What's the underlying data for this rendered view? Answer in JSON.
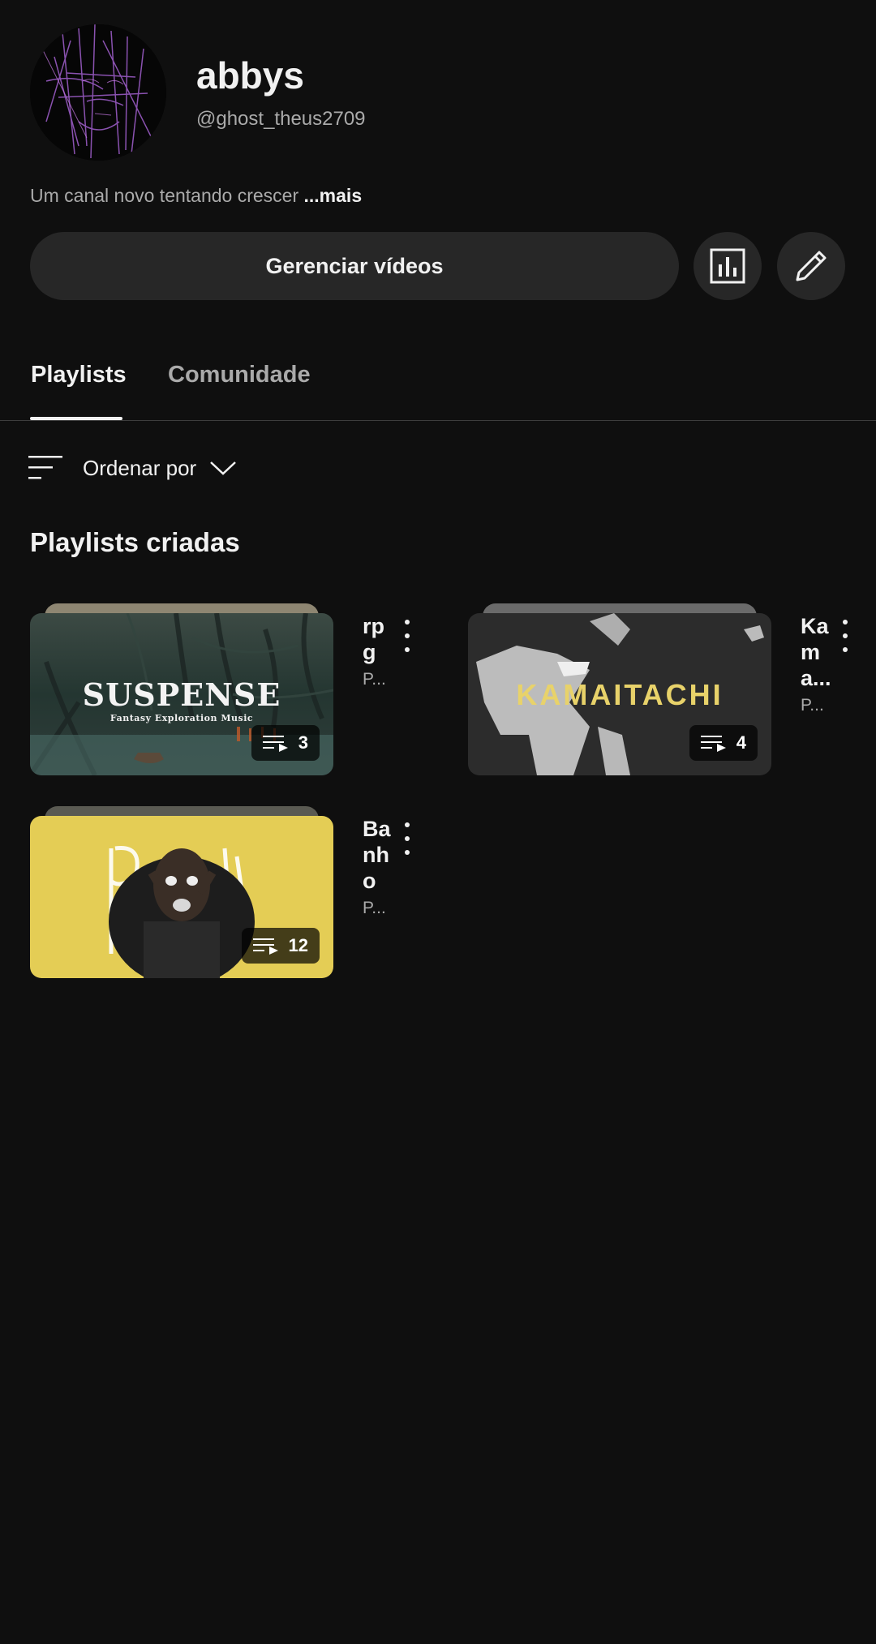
{
  "channel": {
    "name": "abbys",
    "handle": "@ghost_theus2709",
    "description": "Um canal novo tentando crescer",
    "more_label": "...mais"
  },
  "actions": {
    "manage_videos_label": "Gerenciar vídeos",
    "analytics_icon": "bar-chart-icon",
    "edit_icon": "pencil-icon"
  },
  "tabs": [
    {
      "label": "Playlists",
      "active": true
    },
    {
      "label": "Comunidade",
      "active": false
    }
  ],
  "sort": {
    "label": "Ordenar por"
  },
  "section": {
    "title": "Playlists criadas"
  },
  "playlists": [
    {
      "title": "rpg",
      "subtitle": "P...",
      "count": "3",
      "thumb_title": "SUSPENSE",
      "thumb_subtitle": "Fantasy Exploration Music"
    },
    {
      "title": "Kama...",
      "subtitle": "P...",
      "count": "4",
      "thumb_title": "KAMAITACHI"
    },
    {
      "title": "Banho",
      "subtitle": "P...",
      "count": "12"
    }
  ],
  "colors": {
    "background": "#0f0f0f",
    "surface": "#272727",
    "text_primary": "#f1f1f1",
    "text_secondary": "#aaaaaa",
    "kamaitachi_yellow": "#e8d26a",
    "banho_yellow": "#e4cd55"
  }
}
